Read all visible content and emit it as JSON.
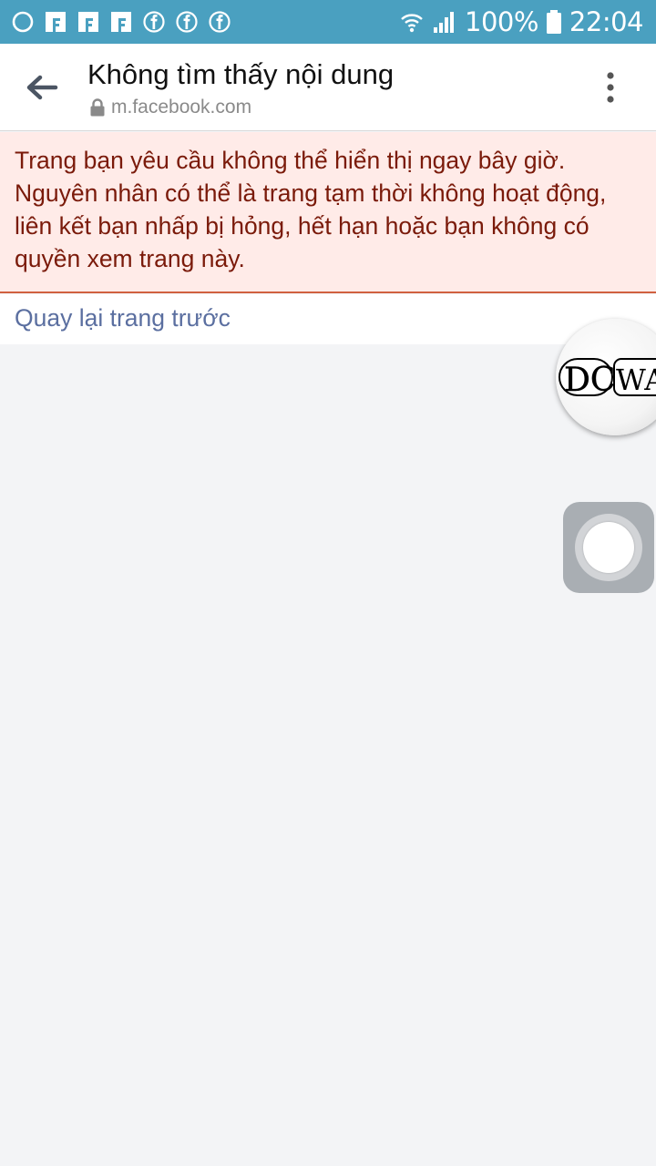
{
  "status_bar": {
    "notification_icons": [
      "circle-icon",
      "facebook-flag-icon",
      "facebook-flag-icon",
      "facebook-flag-icon",
      "facebook-circle-icon",
      "facebook-circle-icon",
      "facebook-circle-icon"
    ],
    "battery_text": "100%",
    "time": "22:04",
    "background_color": "#4aa0c0"
  },
  "app_bar": {
    "title": "Không tìm thấy nội dung",
    "url": "m.facebook.com"
  },
  "error": {
    "message": "Trang bạn yêu cầu không thể hiển thị ngay bây giờ.\nNguyên nhân có thể là trang tạm thời không hoạt động,\nliên kết bạn nhấp bị hỏng, hết hạn hoặc bạn không có\nquyền xem trang này.",
    "background_color": "#ffebe8",
    "text_color": "#7a1a0a"
  },
  "link": {
    "back_label": "Quay lại trang trước",
    "color": "#5b6fa0"
  },
  "overlay": {
    "bubble_logo_text": "DCWAC"
  }
}
